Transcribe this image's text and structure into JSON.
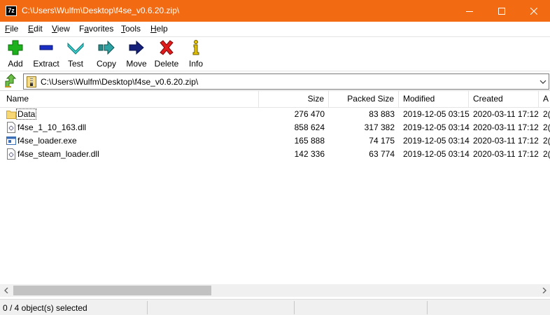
{
  "window": {
    "app_icon_text": "7z",
    "title": "C:\\Users\\Wulfm\\Desktop\\f4se_v0.6.20.zip\\",
    "accent_color": "#f26b12",
    "controls": [
      "minimize-icon",
      "maximize-icon",
      "close-icon"
    ]
  },
  "menu": {
    "file": {
      "u": "F",
      "rest": "ile"
    },
    "edit": {
      "u": "E",
      "rest": "dit"
    },
    "view": {
      "u": "V",
      "rest": "iew"
    },
    "favorites": {
      "pre": "F",
      "u": "a",
      "rest": "vorites"
    },
    "tools": {
      "u": "T",
      "rest": "ools"
    },
    "help": {
      "u": "H",
      "rest": "elp"
    }
  },
  "toolbar": {
    "add": "Add",
    "extract": "Extract",
    "test": "Test",
    "copy": "Copy",
    "move": "Move",
    "delete": "Delete",
    "info": "Info"
  },
  "address": {
    "path": "C:\\Users\\Wulfm\\Desktop\\f4se_v0.6.20.zip\\"
  },
  "columns": {
    "name": "Name",
    "size": "Size",
    "packed": "Packed Size",
    "modified": "Modified",
    "created": "Created",
    "attr": "A"
  },
  "files": [
    {
      "icon": "folder-icon",
      "name": "Data",
      "size": "276 470",
      "packed": "83 883",
      "modified": "2019-12-05 03:15",
      "created": "2020-03-11 17:12",
      "attr": "2("
    },
    {
      "icon": "dll-file-icon",
      "name": "f4se_1_10_163.dll",
      "size": "858 624",
      "packed": "317 382",
      "modified": "2019-12-05 03:14",
      "created": "2020-03-11 17:12",
      "attr": "2("
    },
    {
      "icon": "exe-file-icon",
      "name": "f4se_loader.exe",
      "size": "165 888",
      "packed": "74 175",
      "modified": "2019-12-05 03:14",
      "created": "2020-03-11 17:12",
      "attr": "2("
    },
    {
      "icon": "dll-file-icon",
      "name": "f4se_steam_loader.dll",
      "size": "142 336",
      "packed": "63 774",
      "modified": "2019-12-05 03:14",
      "created": "2020-03-11 17:12",
      "attr": "2("
    }
  ],
  "status": {
    "text": "0 / 4 object(s) selected"
  }
}
